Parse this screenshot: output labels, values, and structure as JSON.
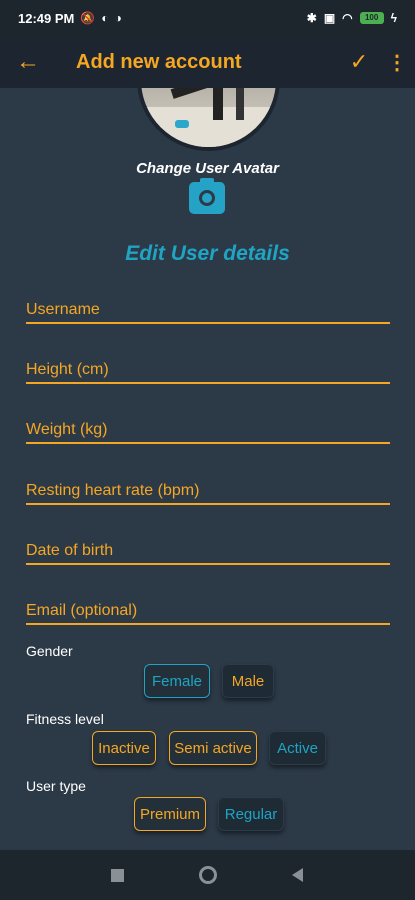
{
  "status_bar": {
    "time": "12:49 PM",
    "battery": "100"
  },
  "app_bar": {
    "title": "Add new account",
    "back_icon": "←",
    "check_icon": "✓",
    "more_icon": "⋮"
  },
  "avatar": {
    "change_label": "Change User Avatar"
  },
  "section_title": "Edit User details",
  "fields": {
    "username": "Username",
    "height": "Height (cm)",
    "weight": "Weight (kg)",
    "resting_hr": "Resting heart rate (bpm)",
    "dob": "Date of birth",
    "email": "Email (optional)"
  },
  "gender": {
    "label": "Gender",
    "options": [
      "Female",
      "Male"
    ],
    "selected": "Female"
  },
  "fitness": {
    "label": "Fitness level",
    "options": [
      "Inactive",
      "Semi active",
      "Active"
    ],
    "selected": "Active"
  },
  "user_type": {
    "label": "User type",
    "options": [
      "Premium",
      "Regular"
    ],
    "selected": "Regular"
  },
  "colors": {
    "accent": "#f5a623",
    "secondary": "#1fa4c4",
    "background": "#2c3a48",
    "bar": "#1d2630"
  }
}
